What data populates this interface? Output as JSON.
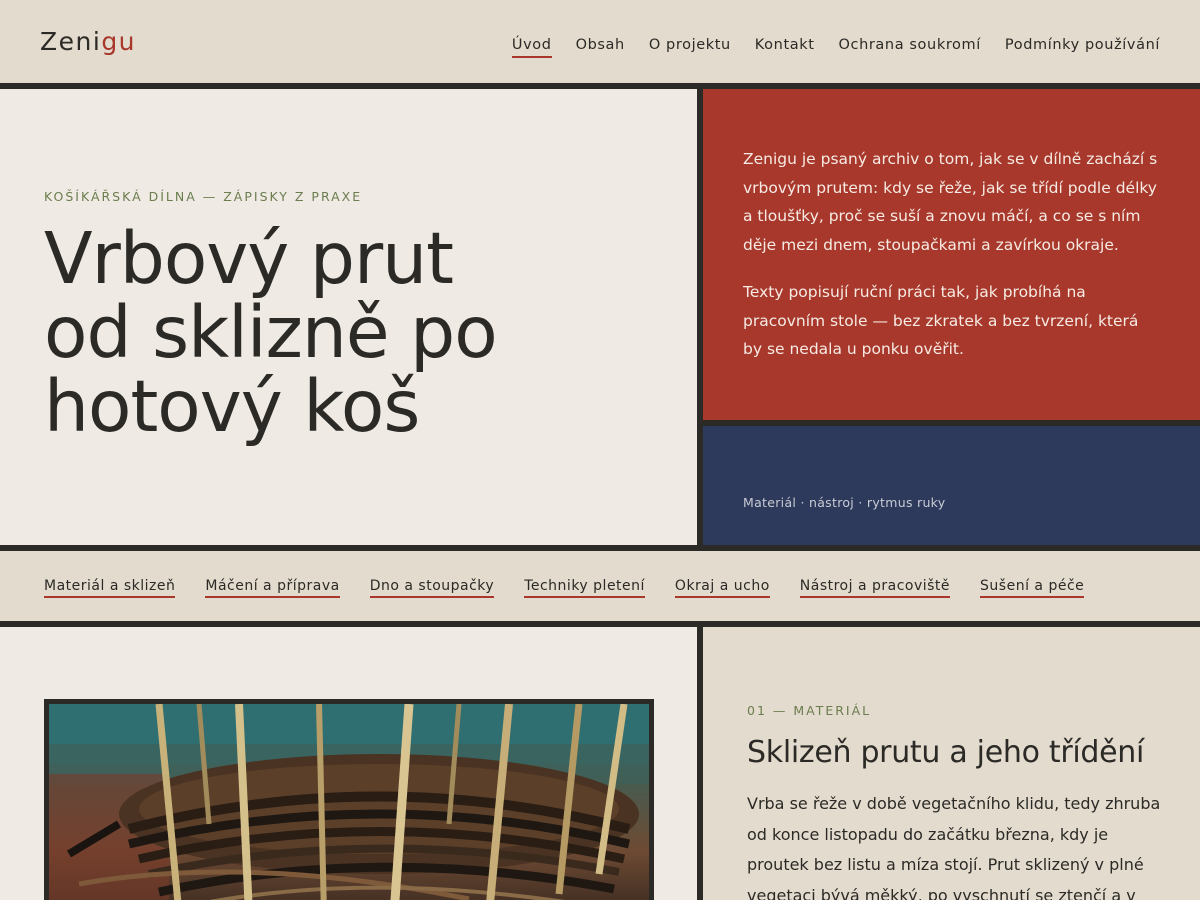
{
  "header": {
    "logo_main": "Zeni",
    "logo_accent": "gu",
    "nav": [
      {
        "label": "Úvod"
      },
      {
        "label": "Obsah"
      },
      {
        "label": "O projektu"
      },
      {
        "label": "Kontakt"
      },
      {
        "label": "Ochrana soukromí"
      },
      {
        "label": "Podmínky používání"
      }
    ]
  },
  "hero": {
    "eyebrow": "KOŠÍKÁŘSKÁ DÍLNA — ZÁPISKY Z PRAXE",
    "title_lines": [
      "Vrbový prut",
      "od sklizně po",
      "hotový koš"
    ],
    "intro_paragraphs": [
      "Zenigu je psaný archiv o tom, jak se v dílně zachází s vrbovým prutem: kdy se řeže, jak se třídí podle délky a tloušťky, proč se suší a znovu máčí, a co se s ním děje mezi dnem, stoupačkami a zavírkou okraje.",
      "Texty popisují ruční práci tak, jak probíhá na pracovním stole — bez zkratek a bez tvrzení, která by se nedala u ponku ověřit."
    ],
    "caption": "Materiál · nástroj · rytmus ruky"
  },
  "topics": [
    {
      "label": "Materiál a sklizeň"
    },
    {
      "label": "Máčení a příprava"
    },
    {
      "label": "Dno a stoupačky"
    },
    {
      "label": "Techniky pletení"
    },
    {
      "label": "Okraj a ucho"
    },
    {
      "label": "Nástroj a pracoviště"
    },
    {
      "label": "Sušení a péče"
    }
  ],
  "section": {
    "eyebrow": "01 — MATERIÁL",
    "title": "Sklizeň prutu a jeho třídění",
    "body": "Vrba se řeže v době vegetačního klidu, tedy zhruba od konce listopadu do začátku března, kdy je proutek bez listu a míza stojí. Prut sklizený v plné vegetaci bývá měkký, po vyschnutí se ztenčí a v"
  },
  "colors": {
    "accent": "#a8382b",
    "navy": "#2d3a5c",
    "olive": "#6b7d4e",
    "sand": "#e3dbcd",
    "paper": "#efeae3",
    "ink": "#2b2a26"
  }
}
